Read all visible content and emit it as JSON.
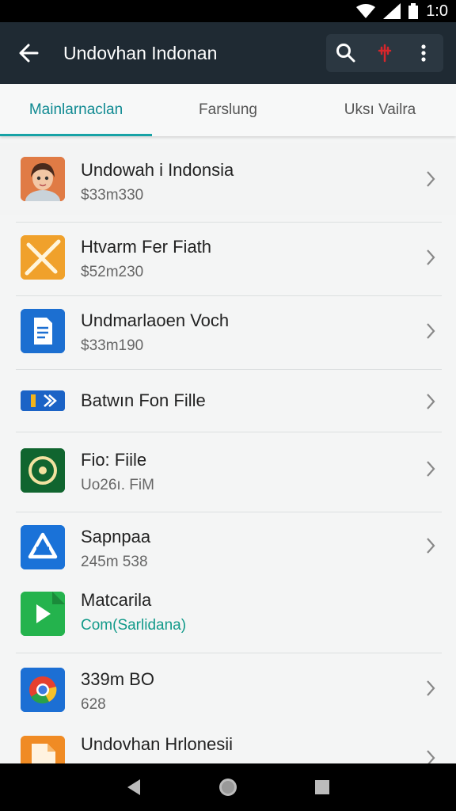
{
  "status": {
    "time": "1:0"
  },
  "app_bar": {
    "title": "Undovhan Indonan"
  },
  "tabs": [
    {
      "label": "Mainlarnaclan",
      "active": true
    },
    {
      "label": "Farslung",
      "active": false
    },
    {
      "label": "Uksı Vailra",
      "active": false
    }
  ],
  "items": [
    {
      "title": "Undowah i Indonsia",
      "subtitle": "$33m330",
      "icon": "avatar-icon"
    },
    {
      "title": "Htvarm Fer Fiath",
      "subtitle": "$52m230",
      "icon": "tools-icon"
    },
    {
      "title": "Undmarlaoen Voch",
      "subtitle": "$33m190",
      "icon": "document-icon"
    },
    {
      "title": "Batwın Fon Fille",
      "subtitle": "",
      "icon": "battery-icon"
    },
    {
      "title": "Fio: Fiile",
      "subtitle": "Uo26ı. FiM",
      "icon": "target-icon"
    },
    {
      "title": "Sapnpaa",
      "subtitle": "245m 538",
      "icon": "triangle-app-icon"
    },
    {
      "title": "Matcarila",
      "subtitle": "Com(Sarlidana)",
      "icon": "play-file-icon"
    },
    {
      "title": "339m BO",
      "subtitle": "628",
      "icon": "chrome-icon"
    },
    {
      "title": "Undovhan Hrlonesii",
      "subtitle": "",
      "icon": "orange-file-icon"
    }
  ],
  "colors": {
    "app_bar": "#1f2a33",
    "accent": "#17a3a6",
    "background": "#f4f5f5"
  }
}
